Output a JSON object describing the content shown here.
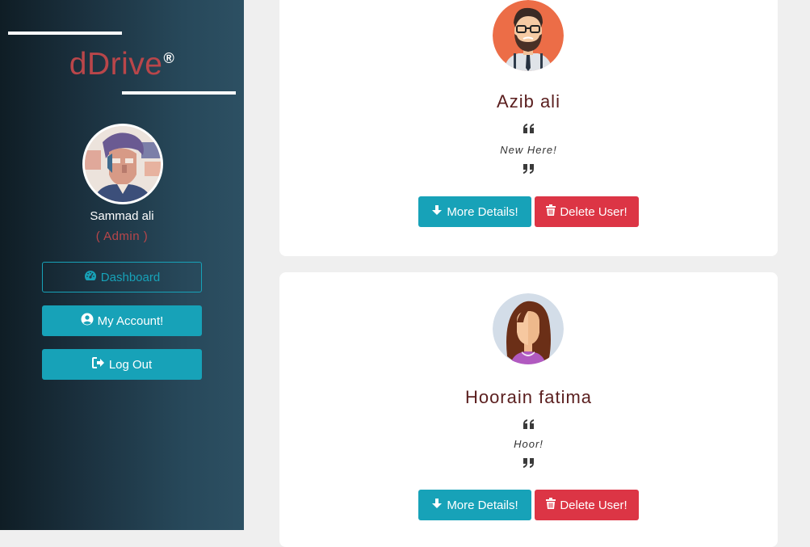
{
  "brand": {
    "name": "dDrive",
    "mark": "®",
    "color": "#b9464a"
  },
  "profile": {
    "name": "Sammad ali",
    "role": "( Admin )"
  },
  "nav": {
    "dashboard": {
      "label": "Dashboard",
      "icon": "gauge-icon"
    },
    "account": {
      "label": "My Account!",
      "icon": "user-circle-icon"
    },
    "logout": {
      "label": "Log Out",
      "icon": "sign-out-icon"
    }
  },
  "users": [
    {
      "name": "Azib ali",
      "status": "New Here!",
      "avatar": "bearded-man-avatar"
    },
    {
      "name": "Hoorain fatima",
      "status": "Hoor!",
      "avatar": "woman-avatar"
    }
  ],
  "actions": {
    "details_label": "More Details!",
    "delete_label": "Delete User!"
  },
  "colors": {
    "primary": "#17a2b8",
    "danger": "#dc3545",
    "name_text": "#5a1e1e"
  }
}
